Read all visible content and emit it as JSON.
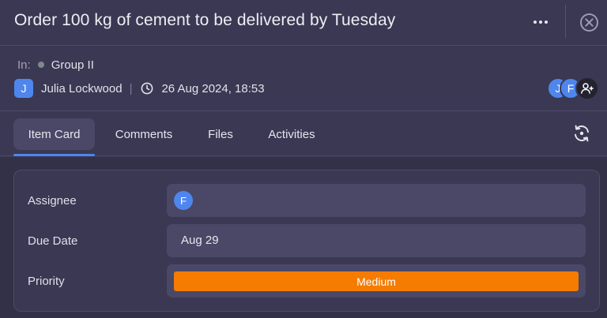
{
  "task": {
    "title": "Order 100 kg of cement to be delivered by Tuesday",
    "in_label": "In:",
    "group": "Group II",
    "author_initial": "J",
    "author_name": "Julia Lockwood",
    "separator": "|",
    "created": "26 Aug 2024, 18:53"
  },
  "members": [
    {
      "initial": "J"
    },
    {
      "initial": "F"
    }
  ],
  "icons": {
    "more": "more-horizontal-icon",
    "close": "close-circle-icon",
    "clock": "clock-icon",
    "add_member": "user-plus-icon",
    "sync": "sync-icon"
  },
  "tabs": [
    {
      "label": "Item Card",
      "active": true
    },
    {
      "label": "Comments",
      "active": false
    },
    {
      "label": "Files",
      "active": false
    },
    {
      "label": "Activities",
      "active": false
    }
  ],
  "fields": {
    "assignee": {
      "label": "Assignee",
      "initial": "F"
    },
    "due_date": {
      "label": "Due Date",
      "value": "Aug 29"
    },
    "priority": {
      "label": "Priority",
      "value": "Medium"
    }
  },
  "colors": {
    "accent": "#4f86ee",
    "priority_medium": "#f57c00",
    "background": "#3a3852"
  }
}
